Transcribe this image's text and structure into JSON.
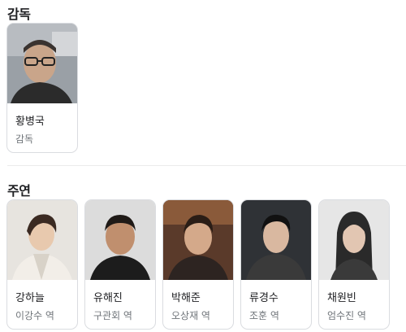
{
  "sections": {
    "director": {
      "title": "감독",
      "people": [
        {
          "name": "황병국",
          "role": "감독"
        }
      ]
    },
    "cast": {
      "title": "주연",
      "people": [
        {
          "name": "강하늘",
          "role": "이강수 역"
        },
        {
          "name": "유해진",
          "role": "구관회 역"
        },
        {
          "name": "박해준",
          "role": "오상재 역"
        },
        {
          "name": "류경수",
          "role": "조훈 역"
        },
        {
          "name": "채원빈",
          "role": "엄수진 역"
        }
      ]
    }
  }
}
